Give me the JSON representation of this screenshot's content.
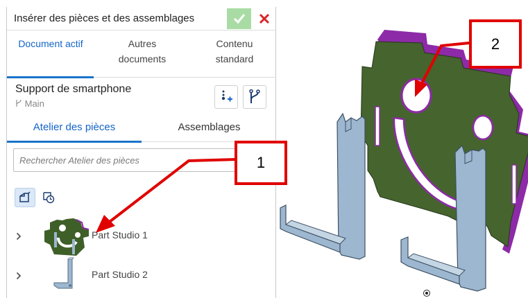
{
  "panel": {
    "title": "Insérer des pièces et des assemblages",
    "confirm_icon": "check-icon",
    "cancel_icon": "close-icon",
    "source_tabs": [
      {
        "label_line1": "Document actif",
        "label_line2": "",
        "active": true
      },
      {
        "label_line1": "Autres",
        "label_line2": "documents",
        "active": false
      },
      {
        "label_line1": "Contenu",
        "label_line2": "standard",
        "active": false
      }
    ],
    "document": {
      "name": "Support de smartphone",
      "branch": "Main"
    },
    "type_tabs": [
      {
        "label": "Atelier des pièces",
        "active": true
      },
      {
        "label": "Assemblages",
        "active": false
      }
    ],
    "search": {
      "placeholder": "Rechercher Atelier des pièces"
    },
    "items": [
      {
        "label": "Part Studio 1"
      },
      {
        "label": "Part Studio 2"
      }
    ]
  },
  "callouts": {
    "first": "1",
    "second": "2"
  },
  "colors": {
    "accent_blue": "#1a73c9",
    "confirm_green": "#a9dca4",
    "cancel_red": "#d9252b",
    "callout_red": "#e00000",
    "plate_green": "#46642e",
    "plate_edge_purple": "#8d2aa8",
    "bracket_blue": "#9cb7cf"
  }
}
